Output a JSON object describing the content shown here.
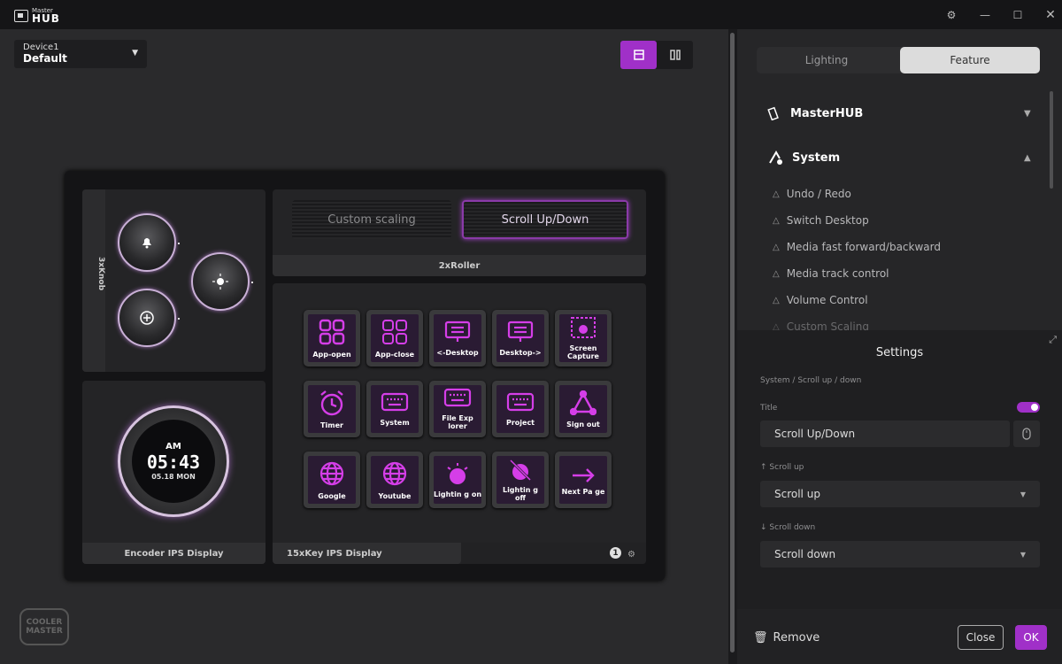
{
  "app": {
    "title_small": "Master",
    "title_big": "HUB",
    "brand_logo": "COOLER MASTER"
  },
  "device": {
    "name": "Device1",
    "profile": "Default"
  },
  "layout": {
    "knob_label": "3xKnob",
    "roller_label": "2xRoller",
    "encoder_label": "Encoder IPS Display",
    "keys_label": "15xKey IPS Display",
    "page_badge": "1",
    "rollers": [
      "Custom scaling",
      "Scroll Up/Down"
    ],
    "clock": {
      "ampm": "AM",
      "time": "05:43",
      "date": "05.18 MON"
    },
    "keys": [
      {
        "label": "App-open",
        "icon": "grid-icon"
      },
      {
        "label": "App-close",
        "icon": "grid-outline-icon"
      },
      {
        "label": "<-Desktop",
        "icon": "desktop-icon"
      },
      {
        "label": "Desktop->",
        "icon": "desktop-icon"
      },
      {
        "label": "Screen Capture",
        "icon": "screen-capture-icon"
      },
      {
        "label": "Timer",
        "icon": "alarm-clock-icon"
      },
      {
        "label": "System",
        "icon": "keyboard-icon"
      },
      {
        "label": "File Exp lorer",
        "icon": "keyboard-icon"
      },
      {
        "label": "Project",
        "icon": "keyboard-icon"
      },
      {
        "label": "Sign out",
        "icon": "network-icon"
      },
      {
        "label": "Google",
        "icon": "globe-icon"
      },
      {
        "label": "Youtube",
        "icon": "globe-icon"
      },
      {
        "label": "Lightin g on",
        "icon": "light-on-icon"
      },
      {
        "label": "Lightin g off",
        "icon": "light-off-icon"
      },
      {
        "label": "Next Pa ge",
        "icon": "arrow-right-icon"
      }
    ]
  },
  "panel": {
    "tabs": [
      "Lighting",
      "Feature"
    ],
    "categories": [
      "MasterHUB",
      "System"
    ],
    "features": [
      "Undo / Redo",
      "Switch Desktop",
      "Media fast forward/backward",
      "Media track control",
      "Volume Control",
      "Custom Scaling"
    ]
  },
  "settings": {
    "title": "Settings",
    "path": "System / Scroll up / down",
    "title_label": "Title",
    "title_value": "Scroll Up/Down",
    "scroll_up_label": "Scroll up",
    "scroll_up_value": "Scroll up",
    "scroll_down_label": "Scroll down",
    "scroll_down_value": "Scroll down"
  },
  "footer": {
    "remove": "Remove",
    "close": "Close",
    "ok": "OK"
  },
  "colors": {
    "accent": "#a030c8",
    "key_glyph": "#d53ee8"
  }
}
